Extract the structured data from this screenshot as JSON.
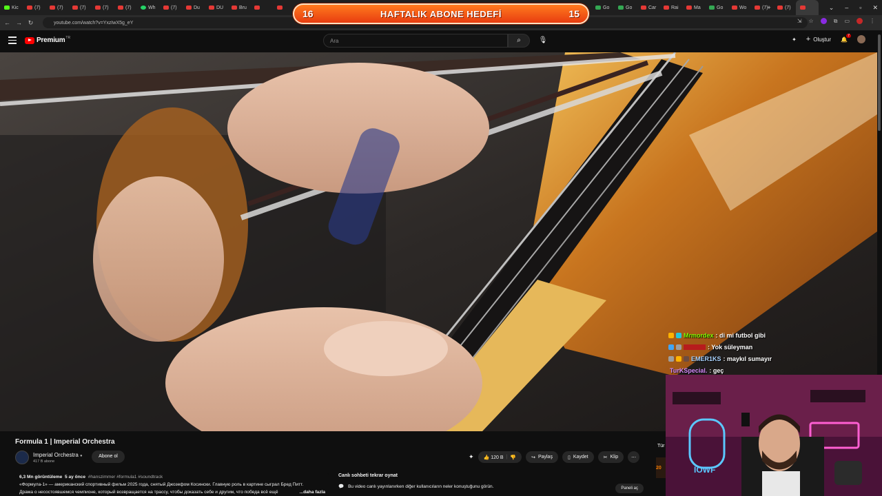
{
  "browser": {
    "tabs": [
      "Kic",
      "(7)",
      "(7)",
      "(7)",
      "(7)",
      "(7)",
      "Wh",
      "(7)",
      "Du",
      "DU",
      "Bru",
      "",
      "",
      "",
      "",
      "",
      "",
      "",
      "",
      "",
      "",
      "",
      "",
      "",
      "",
      "",
      "Go",
      "Go",
      "Car",
      "Rai",
      "Ma",
      "Go",
      "Wo",
      "(7)",
      "(7)",
      ""
    ],
    "url": "youtube.com/watch?v=YxzIwX5g_eY"
  },
  "overlay": {
    "left_count": "16",
    "title": "HAFTALIK ABONE HEDEFİ",
    "right_count": "15"
  },
  "youtube": {
    "logo_text": "Premium",
    "logo_country": "TR",
    "search_placeholder": "Ara",
    "create_label": "Oluştur",
    "notification_count": "7"
  },
  "video": {
    "title": "Formula 1 | Imperial Orchestra",
    "channel_name": "Imperial Orchestra",
    "subscribers": "417 B abone",
    "subscribe_label": "Abone ol",
    "likes": "120 B",
    "share_label": "Paylaş",
    "save_label": "Kaydet",
    "clip_label": "Klip",
    "views": "6,3 Mn görüntüleme",
    "age": "5 ay önce",
    "tags": "#hanszimmer #formula1 #soundtrack",
    "desc_line1": "«Формула-1» — американский спортивный фильм 2025 года, снятый Джозефом Косински. Главную роль в картине сыграл Бред Питт.",
    "desc_line2": "Драма о несостоявшемся чемпионе, который возвращается на трассу, чтобы доказать себе и другим, что победа всё ещё",
    "more_label": "...daha fazla"
  },
  "chat_replay": {
    "title": "Canlı sohbeti tekrar oynat",
    "subtitle": "Bu video canlı yayınlanırken diğer kullanıcıların neler konuştuğunu görün.",
    "open_panel": "Paneli aç"
  },
  "side_partial": {
    "label1": "Tür",
    "label2": "20"
  },
  "stream_chat": [
    {
      "user": "Mrmordex",
      "message": "di mi futbol gibi",
      "color": "#7CFC00"
    },
    {
      "user": "",
      "message": "Yok süleyman",
      "color": "#e53935"
    },
    {
      "user": "EMER1KS",
      "message": "maykıl sumayır",
      "color": "#aad4ff"
    },
    {
      "user": "TurKSpecial.",
      "message": "geç",
      "color": "#d88cff"
    }
  ],
  "webcam": {
    "neon_text": "IOWF"
  }
}
